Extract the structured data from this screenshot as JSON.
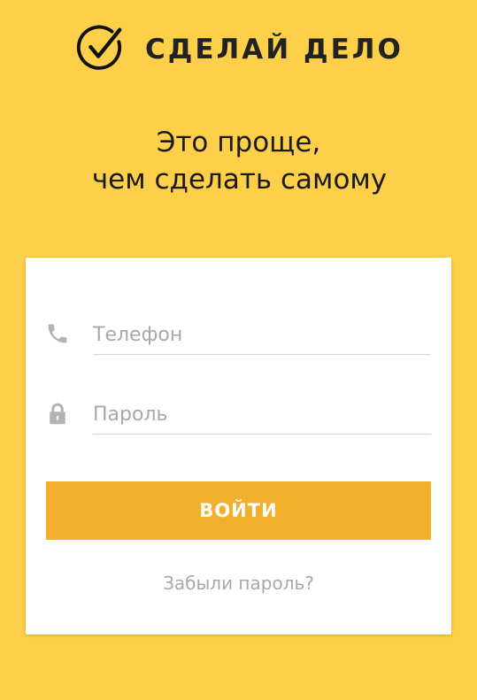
{
  "brand": {
    "name": "СДЕЛАЙ ДЕЛО",
    "logo_icon": "check-circle-icon"
  },
  "tagline": {
    "line1": "Это проще,",
    "line2": "чем сделать самому"
  },
  "login_form": {
    "phone": {
      "icon": "phone-icon",
      "placeholder": "Телефон",
      "value": ""
    },
    "password": {
      "icon": "lock-icon",
      "placeholder": "Пароль",
      "value": ""
    },
    "submit_label": "ВОЙТИ",
    "forgot_password_label": "Забыли пароль?"
  },
  "colors": {
    "background": "#FECF48",
    "button": "#F2AF2B",
    "card": "#FFFFFF",
    "placeholder": "#A8A8A8",
    "icon": "#B3B3B3"
  }
}
